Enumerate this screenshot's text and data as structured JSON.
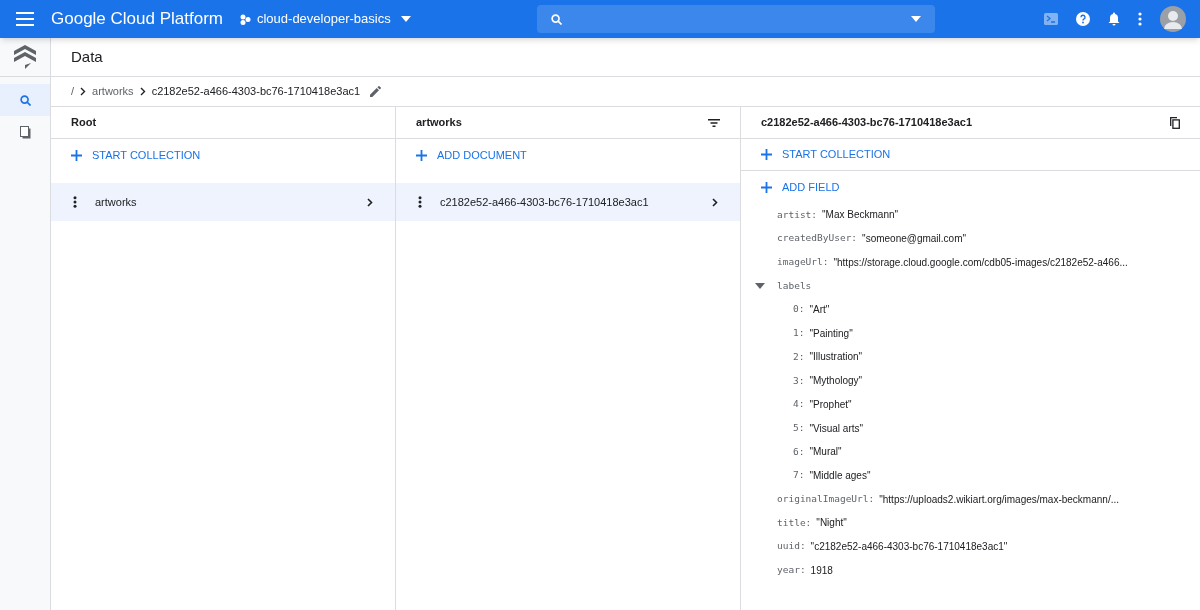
{
  "header": {
    "product": "Google Cloud Platform",
    "project": "cloud-developer-basics"
  },
  "sidebar": {
    "items": [
      {
        "kind": "search",
        "selected": true
      },
      {
        "kind": "docs",
        "selected": false
      }
    ]
  },
  "page_title": "Data",
  "breadcrumb": [
    "/",
    "artworks",
    "c2182e52-a466-4303-bc76-1710418e3ac1"
  ],
  "columns": [
    {
      "kind": "root",
      "title": "Root",
      "action": "START COLLECTION",
      "items": [
        {
          "label": "artworks",
          "selected": true
        }
      ]
    },
    {
      "kind": "collection",
      "title": "artworks",
      "action": "ADD DOCUMENT",
      "items": [
        {
          "label": "c2182e52-a466-4303-bc76-1710418e3ac1",
          "selected": true
        }
      ]
    },
    {
      "kind": "document",
      "title": "c2182e52-a466-4303-bc76-1710418e3ac1",
      "action": "START COLLECTION",
      "add_field": "ADD FIELD",
      "fields": [
        {
          "key": "artist:",
          "value": "\"Max Beckmann\""
        },
        {
          "key": "createdByUser:",
          "value": "\"someone@gmail.com\""
        },
        {
          "key": "imageUrl:",
          "value": "\"https://storage.cloud.google.com/cdb05-images/c2182e52-a466..."
        },
        {
          "key": "labels",
          "expanded": true,
          "children": [
            {
              "key": "0:",
              "value": "\"Art\""
            },
            {
              "key": "1:",
              "value": "\"Painting\""
            },
            {
              "key": "2:",
              "value": "\"Illustration\""
            },
            {
              "key": "3:",
              "value": "\"Mythology\""
            },
            {
              "key": "4:",
              "value": "\"Prophet\""
            },
            {
              "key": "5:",
              "value": "\"Visual arts\""
            },
            {
              "key": "6:",
              "value": "\"Mural\""
            },
            {
              "key": "7:",
              "value": "\"Middle ages\""
            }
          ]
        },
        {
          "key": "originalImageUrl:",
          "value": "\"https://uploads2.wikiart.org/images/max-beckmann/..."
        },
        {
          "key": "title:",
          "value": "\"Night\""
        },
        {
          "key": "uuid:",
          "value": "\"c2182e52-a466-4303-bc76-1710418e3ac1\""
        },
        {
          "key": "year:",
          "value": "1918"
        }
      ]
    }
  ]
}
